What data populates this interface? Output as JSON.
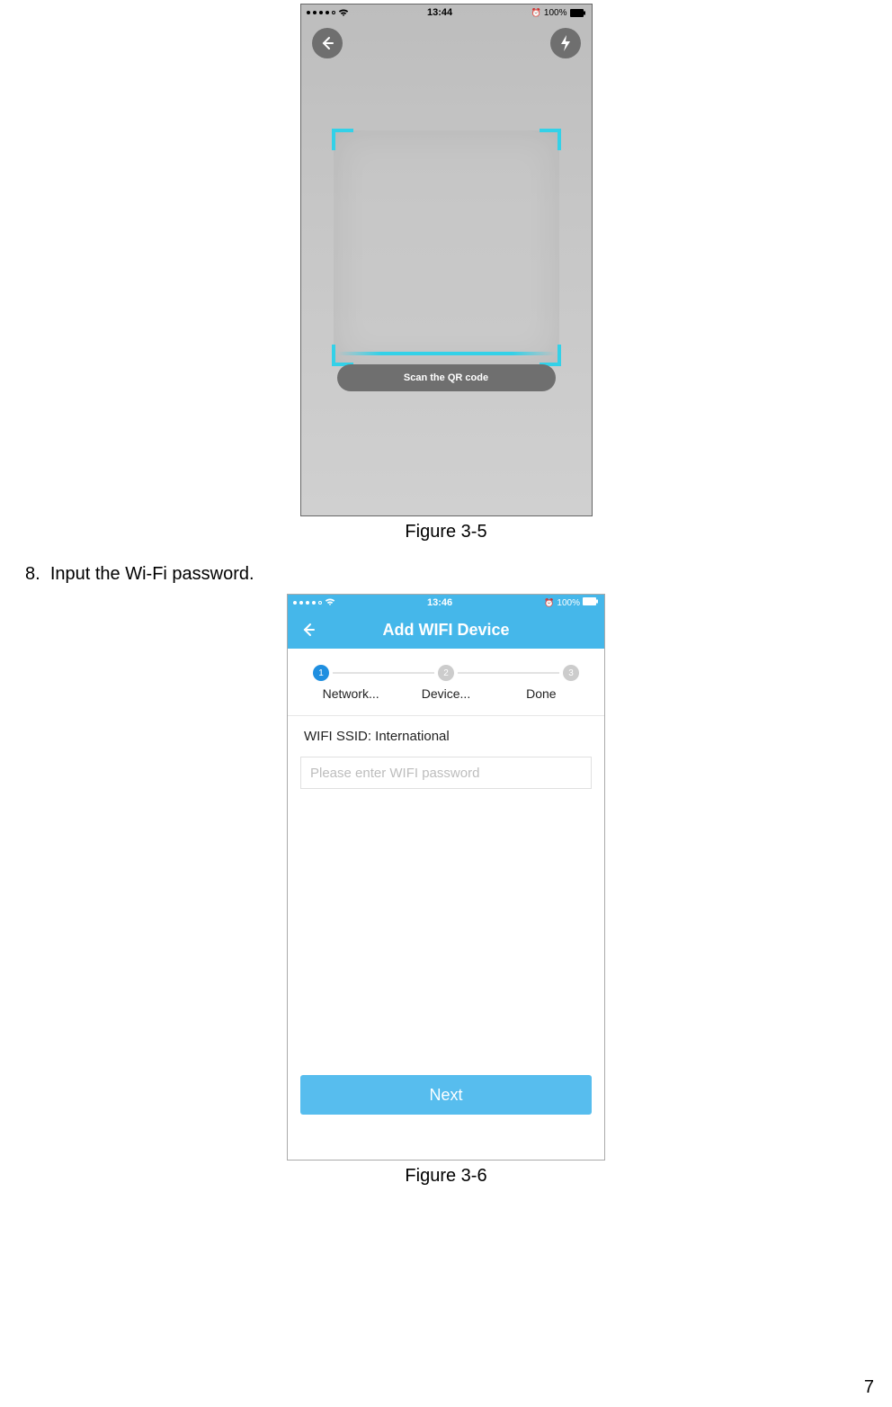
{
  "page_number": "7",
  "figure1": {
    "caption": "Figure 3-5",
    "status": {
      "time": "13:44",
      "battery_pct": "100%",
      "alarm_icon": "⏰"
    },
    "scan_button_label": "Scan the QR code"
  },
  "step": {
    "number": "8.",
    "text": "Input the Wi-Fi password."
  },
  "figure2": {
    "caption": "Figure 3-6",
    "status": {
      "time": "13:46",
      "battery_pct": "100%",
      "alarm_icon": "⏰"
    },
    "nav_title": "Add WIFI Device",
    "steps": {
      "s1": "1",
      "s2": "2",
      "s3": "3",
      "l1": "Network...",
      "l2": "Device...",
      "l3": "Done"
    },
    "ssid_label": "WIFI SSID: International",
    "password_placeholder": "Please  enter WIFI password",
    "next_label": "Next"
  }
}
